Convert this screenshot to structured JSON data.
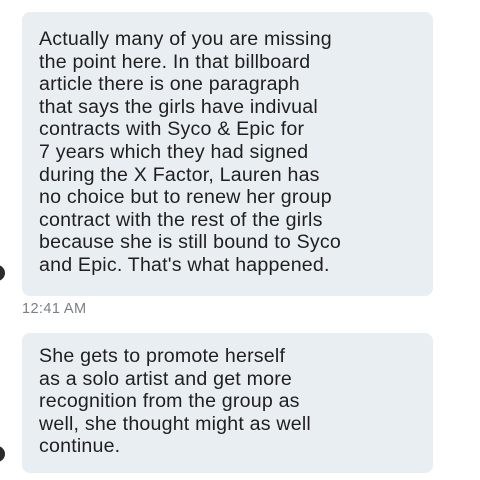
{
  "conversation": {
    "messages": [
      {
        "text": "Actually many of you are missing\nthe point here. In that billboard\narticle there is one paragraph\nthat says the girls have indivual\ncontracts with Syco & Epic for\n7 years which they had signed\nduring the X Factor, Lauren has\nno choice but to renew her group\ncontract with the rest of the girls\nbecause she is still bound to Syco\nand Epic. That's what happened."
      },
      {
        "text": "She gets to promote herself\nas a solo artist and get more\nrecognition from the group as\nwell, she thought might as well\ncontinue."
      }
    ],
    "timestamp": "12:41 AM"
  },
  "colors": {
    "bubble_background": "#e9eef3",
    "text": "#1f1f1f",
    "timestamp": "#7a7f85",
    "page_background": "#ffffff"
  }
}
